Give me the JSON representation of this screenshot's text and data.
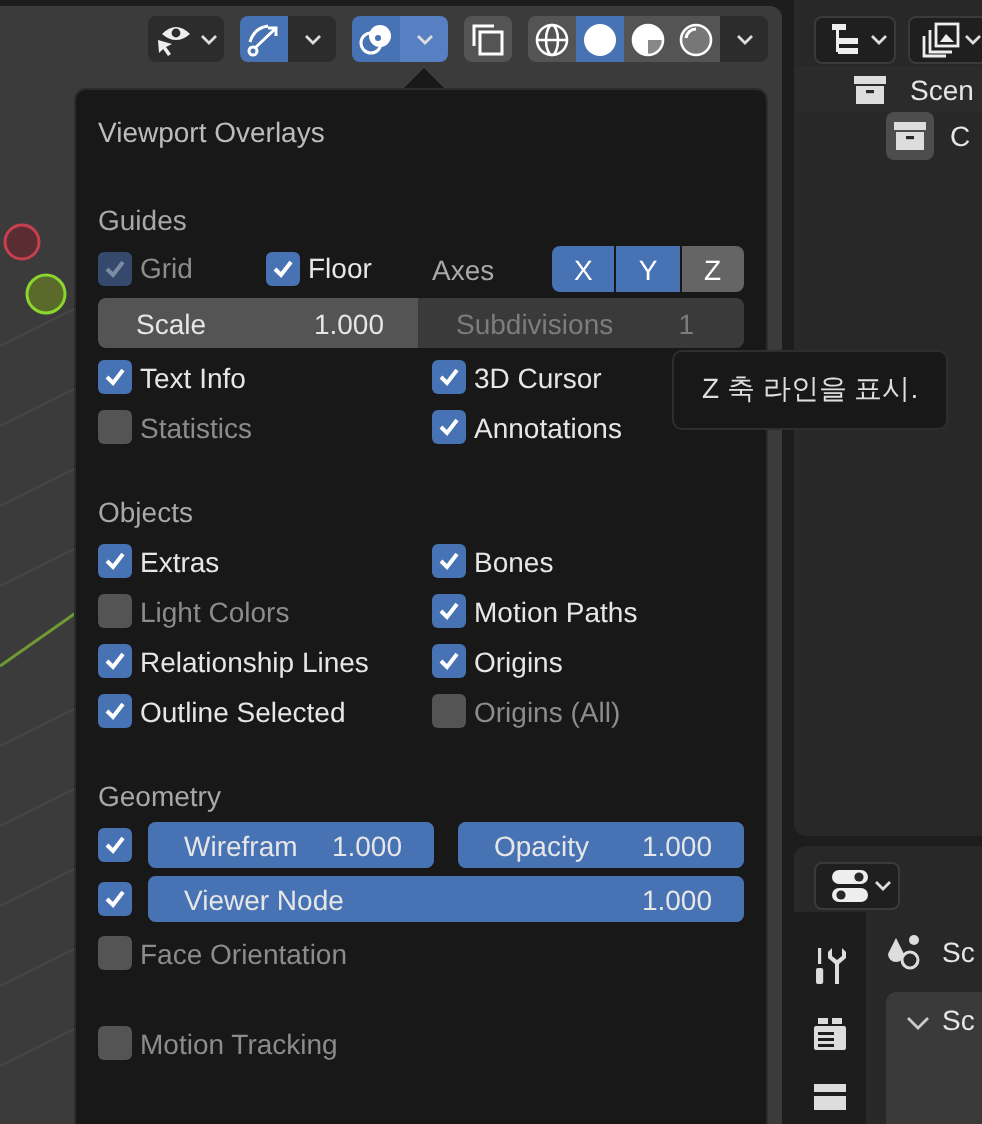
{
  "toolbar": [
    {
      "buttons": [
        {
          "kind": "visibility",
          "selected": false
        }
      ]
    },
    {
      "buttons": [
        {
          "kind": "gizmos",
          "selected": true
        },
        {
          "kind": "menu",
          "selected": false
        }
      ]
    },
    {
      "buttons": [
        {
          "kind": "overlays",
          "selected": true
        },
        {
          "kind": "menu",
          "selected": true
        }
      ]
    },
    {
      "buttons": [
        {
          "kind": "xray",
          "selected": false
        }
      ]
    },
    {
      "buttons": [
        {
          "kind": "wireframe",
          "selected": false
        },
        {
          "kind": "solid",
          "selected": true
        },
        {
          "kind": "material",
          "selected": false
        },
        {
          "kind": "rendered",
          "selected": false
        },
        {
          "kind": "menu",
          "selected": false
        }
      ]
    }
  ],
  "overlays": {
    "title": "Viewport Overlays",
    "sections": [
      {
        "heading": "Guides",
        "rows": [
          {
            "kind": "grid",
            "items": [
              {
                "label": "Grid",
                "checked": true,
                "disabled": true
              },
              {
                "label": "Floor",
                "checked": true,
                "disabled": false
              }
            ],
            "axes_label": "Axes",
            "axes": [
              {
                "label": "X",
                "selected": true
              },
              {
                "label": "Y",
                "selected": true
              },
              {
                "label": "Z",
                "selected": false
              }
            ]
          },
          {
            "kind": "fields",
            "fields": [
              {
                "label": "Scale",
                "value": "1.000",
                "disabled": false
              },
              {
                "label": "Subdivisions",
                "value": "1",
                "disabled": true
              }
            ]
          },
          {
            "kind": "checks",
            "items": [
              {
                "label": "Text Info",
                "checked": true
              },
              {
                "label": "3D Cursor",
                "checked": true
              }
            ]
          },
          {
            "kind": "checks",
            "items": [
              {
                "label": "Statistics",
                "checked": false
              },
              {
                "label": "Annotations",
                "checked": true
              }
            ]
          }
        ]
      },
      {
        "heading": "Objects",
        "rows": [
          {
            "kind": "checks",
            "items": [
              {
                "label": "Extras",
                "checked": true
              },
              {
                "label": "Bones",
                "checked": true
              }
            ]
          },
          {
            "kind": "checks",
            "items": [
              {
                "label": "Light Colors",
                "checked": false
              },
              {
                "label": "Motion Paths",
                "checked": true
              }
            ]
          },
          {
            "kind": "checks",
            "items": [
              {
                "label": "Relationship Lines",
                "checked": true
              },
              {
                "label": "Origins",
                "checked": true
              }
            ]
          },
          {
            "kind": "checks",
            "items": [
              {
                "label": "Outline Selected",
                "checked": true
              },
              {
                "label": "Origins (All)",
                "checked": false
              }
            ]
          }
        ]
      },
      {
        "heading": "Geometry",
        "rows": [
          {
            "kind": "sliders",
            "checked": true,
            "sliders": [
              {
                "label": "Wirefram",
                "value": "1.000",
                "level": 1
              },
              {
                "label": "Opacity",
                "value": "1.000",
                "level": 1
              }
            ]
          },
          {
            "kind": "sliders",
            "checked": true,
            "sliders": [
              {
                "label": "Viewer Node",
                "value": "1.000",
                "level": 1
              }
            ]
          },
          {
            "kind": "checks",
            "items": [
              {
                "label": "Face Orientation",
                "checked": false
              }
            ]
          }
        ]
      },
      {
        "rows": [
          {
            "kind": "checks",
            "items": [
              {
                "label": "Motion Tracking",
                "checked": false
              }
            ]
          }
        ]
      }
    ]
  },
  "tooltip": "Z 축 라인을 표시.",
  "outliner": {
    "header": [
      {
        "kind": "display_mode"
      },
      {
        "kind": "filter"
      }
    ],
    "tree": [
      {
        "label": "Scen",
        "active": false,
        "children": [
          {
            "label": "C",
            "active": true
          }
        ]
      }
    ]
  },
  "properties": {
    "header": [
      {
        "kind": "editor_type"
      }
    ],
    "tabs": [
      {
        "kind": "tool"
      },
      {
        "kind": "render"
      },
      {
        "kind": "output"
      }
    ],
    "context": "Sc",
    "panel": {
      "title": "Sc",
      "expanded": true
    }
  }
}
